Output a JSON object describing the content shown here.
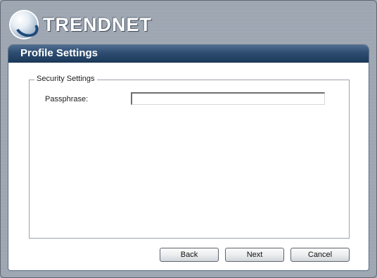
{
  "brand": {
    "name": "TRENDnet",
    "logo_text": "TRENDNET"
  },
  "panel": {
    "title": "Profile Settings"
  },
  "security": {
    "legend": "Security Settings",
    "passphrase_label": "Passphrase:",
    "passphrase_value": ""
  },
  "buttons": {
    "back": "Back",
    "next": "Next",
    "cancel": "Cancel"
  },
  "colors": {
    "header_dark": "#1c3a5c",
    "header_light": "#4f6d90",
    "frame_background": "#a5adb8"
  }
}
